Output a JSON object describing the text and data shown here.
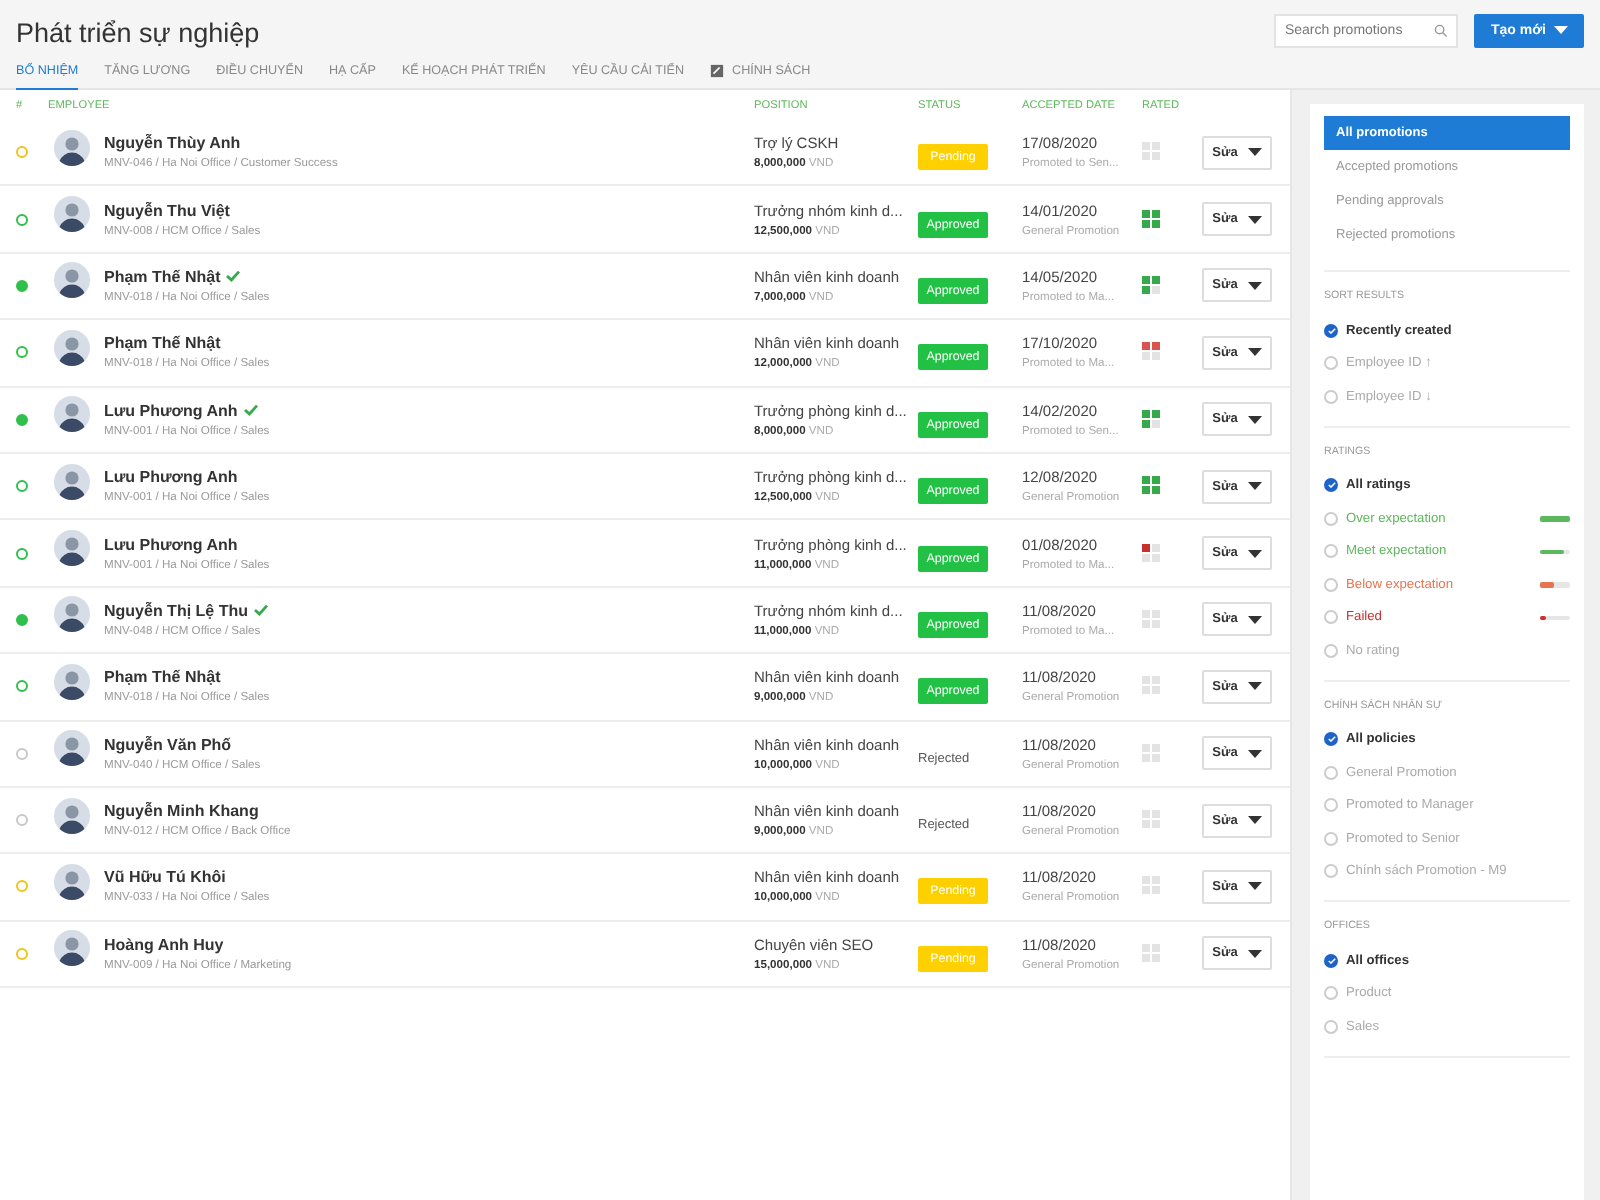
{
  "title": "Phát triển sự nghiệp",
  "tabs": [
    {
      "label": "BỔ NHIỆM",
      "selected": true,
      "kind": "plain"
    },
    {
      "label": "TĂNG LƯƠNG",
      "selected": false,
      "kind": "plain"
    },
    {
      "label": "ĐIỀU CHUYỂN",
      "selected": false,
      "kind": "plain"
    },
    {
      "label": "HẠ CẤP",
      "selected": false,
      "kind": "plain"
    },
    {
      "label": "KẾ HOẠCH PHÁT TRIỂN",
      "selected": false,
      "kind": "plain"
    },
    {
      "label": "YÊU CẦU CẢI TIẾN",
      "selected": false,
      "kind": "plain"
    },
    {
      "label": "CHÍNH SÁCH",
      "selected": false,
      "kind": "document"
    }
  ],
  "search": {
    "placeholder": "Search promotions"
  },
  "create_button": {
    "label": "Tạo mới"
  },
  "table": {
    "columns": [
      "#",
      "EMPLOYEE",
      "POSITION",
      "STATUS",
      "ACCEPTED DATE",
      "RATED"
    ],
    "rows": [
      {
        "name": "Nguyễn Thùy Anh",
        "verified": false,
        "code": "MNV-046 / Ha Noi Office / Customer Success",
        "position": "Trợ lý CSKH",
        "salary": "8,000,000",
        "currency": "VND",
        "status": {
          "kind": "pending",
          "label": "Pending"
        },
        "date": "17/08/2020",
        "policy": "Promoted to Sen...",
        "rating": {
          "kind": "none"
        },
        "action": "Sửa"
      },
      {
        "name": "Nguyễn Thu Việt",
        "verified": false,
        "code": "MNV-008 / HCM Office / Sales",
        "position": "Trưởng nhóm kinh d...",
        "salary": "12,500,000",
        "currency": "VND",
        "status": {
          "kind": "approved",
          "label": "Approved"
        },
        "date": "14/01/2020",
        "policy": "General Promotion",
        "rating": {
          "kind": "over"
        },
        "action": "Sửa"
      },
      {
        "name": "Phạm Thế Nhật",
        "verified": true,
        "code": "MNV-018 / Ha Noi Office / Sales",
        "position": "Nhân viên kinh doanh",
        "salary": "7,000,000",
        "currency": "VND",
        "status": {
          "kind": "approved",
          "label": "Approved"
        },
        "date": "14/05/2020",
        "policy": "Promoted to Ma...",
        "rating": {
          "kind": "meet"
        },
        "action": "Sửa"
      },
      {
        "name": "Phạm Thế Nhật",
        "verified": false,
        "code": "MNV-018 / Ha Noi Office / Sales",
        "position": "Nhân viên kinh doanh",
        "salary": "12,000,000",
        "currency": "VND",
        "status": {
          "kind": "approved",
          "label": "Approved"
        },
        "date": "17/10/2020",
        "policy": "Promoted to Ma...",
        "rating": {
          "kind": "below"
        },
        "action": "Sửa"
      },
      {
        "name": "Lưu Phương Anh",
        "verified": true,
        "code": "MNV-001 / Ha Noi Office / Sales",
        "position": "Trưởng phòng kinh d...",
        "salary": "8,000,000",
        "currency": "VND",
        "status": {
          "kind": "approved",
          "label": "Approved"
        },
        "date": "14/02/2020",
        "policy": "Promoted to Sen...",
        "rating": {
          "kind": "meet"
        },
        "action": "Sửa"
      },
      {
        "name": "Lưu Phương Anh",
        "verified": false,
        "code": "MNV-001 / Ha Noi Office / Sales",
        "position": "Trưởng phòng kinh d...",
        "salary": "12,500,000",
        "currency": "VND",
        "status": {
          "kind": "approved",
          "label": "Approved"
        },
        "date": "12/08/2020",
        "policy": "General Promotion",
        "rating": {
          "kind": "over"
        },
        "action": "Sửa"
      },
      {
        "name": "Lưu Phương Anh",
        "verified": false,
        "code": "MNV-001 / Ha Noi Office / Sales",
        "position": "Trưởng phòng kinh d...",
        "salary": "11,000,000",
        "currency": "VND",
        "status": {
          "kind": "approved",
          "label": "Approved"
        },
        "date": "01/08/2020",
        "policy": "Promoted to Ma...",
        "rating": {
          "kind": "failed"
        },
        "action": "Sửa"
      },
      {
        "name": "Nguyễn Thị Lệ Thu",
        "verified": true,
        "code": "MNV-048 / HCM Office / Sales",
        "position": "Trưởng nhóm kinh d...",
        "salary": "11,000,000",
        "currency": "VND",
        "status": {
          "kind": "approved",
          "label": "Approved"
        },
        "date": "11/08/2020",
        "policy": "Promoted to Ma...",
        "rating": {
          "kind": "none"
        },
        "action": "Sửa"
      },
      {
        "name": "Phạm Thế Nhật",
        "verified": false,
        "code": "MNV-018 / Ha Noi Office / Sales",
        "position": "Nhân viên kinh doanh",
        "salary": "9,000,000",
        "currency": "VND",
        "status": {
          "kind": "approved",
          "label": "Approved"
        },
        "date": "11/08/2020",
        "policy": "General Promotion",
        "rating": {
          "kind": "none"
        },
        "action": "Sửa"
      },
      {
        "name": "Nguyễn Văn Phố",
        "verified": false,
        "code": "MNV-040 / HCM Office / Sales",
        "position": "Nhân viên kinh doanh",
        "salary": "10,000,000",
        "currency": "VND",
        "status": {
          "kind": "rejected",
          "label": "Rejected"
        },
        "date": "11/08/2020",
        "policy": "General Promotion",
        "rating": {
          "kind": "none"
        },
        "action": "Sửa"
      },
      {
        "name": "Nguyễn Minh Khang",
        "verified": false,
        "code": "MNV-012 / HCM Office / Back Office",
        "position": "Nhân viên kinh doanh",
        "salary": "9,000,000",
        "currency": "VND",
        "status": {
          "kind": "rejected",
          "label": "Rejected"
        },
        "date": "11/08/2020",
        "policy": "General Promotion",
        "rating": {
          "kind": "none"
        },
        "action": "Sửa"
      },
      {
        "name": "Vũ Hữu Tú Khôi",
        "verified": false,
        "code": "MNV-033 / Ha Noi Office / Sales",
        "position": "Nhân viên kinh doanh",
        "salary": "10,000,000",
        "currency": "VND",
        "status": {
          "kind": "pending",
          "label": "Pending"
        },
        "date": "11/08/2020",
        "policy": "General Promotion",
        "rating": {
          "kind": "none"
        },
        "action": "Sửa"
      },
      {
        "name": "Hoàng Anh Huy",
        "verified": false,
        "code": "MNV-009 / Ha Noi Office / Marketing",
        "position": "Chuyên viên SEO",
        "salary": "15,000,000",
        "currency": "VND",
        "status": {
          "kind": "pending",
          "label": "Pending"
        },
        "date": "11/08/2020",
        "policy": "General Promotion",
        "rating": {
          "kind": "none"
        },
        "action": "Sửa"
      }
    ]
  },
  "sidebar": {
    "views": [
      {
        "label": "All promotions",
        "selected": true
      },
      {
        "label": "Accepted promotions",
        "selected": false
      },
      {
        "label": "Pending approvals",
        "selected": false
      },
      {
        "label": "Rejected promotions",
        "selected": false
      }
    ],
    "sections": [
      {
        "title": "SORT RESULTS",
        "options": [
          {
            "label": "Recently created",
            "checked": true
          },
          {
            "label": "Employee ID ↑",
            "checked": false
          },
          {
            "label": "Employee ID ↓",
            "checked": false
          }
        ]
      },
      {
        "title": "RATINGS",
        "options": [
          {
            "label": "All ratings",
            "checked": true
          },
          {
            "label": "Over expectation",
            "checked": false,
            "color": "#5cb85c",
            "level": 1
          },
          {
            "label": "Meet expectation",
            "checked": false,
            "color": "#5cb85c",
            "level": 0.8
          },
          {
            "label": "Below expectation",
            "checked": false,
            "color": "#e8734f",
            "level": 0.45
          },
          {
            "label": "Failed",
            "checked": false,
            "color": "#c9302c",
            "level": 0.2
          },
          {
            "label": "No rating",
            "checked": false
          }
        ]
      },
      {
        "title": "CHÍNH SÁCH NHÂN SỰ",
        "options": [
          {
            "label": "All policies",
            "checked": true
          },
          {
            "label": "General Promotion",
            "checked": false
          },
          {
            "label": "Promoted to Manager",
            "checked": false
          },
          {
            "label": "Promoted to Senior",
            "checked": false
          },
          {
            "label": "Chính sách Promotion - M9",
            "checked": false
          }
        ]
      },
      {
        "title": "OFFICES",
        "options": [
          {
            "label": "All offices",
            "checked": true
          },
          {
            "label": "Product",
            "checked": false
          },
          {
            "label": "Sales",
            "checked": false
          }
        ]
      }
    ]
  }
}
